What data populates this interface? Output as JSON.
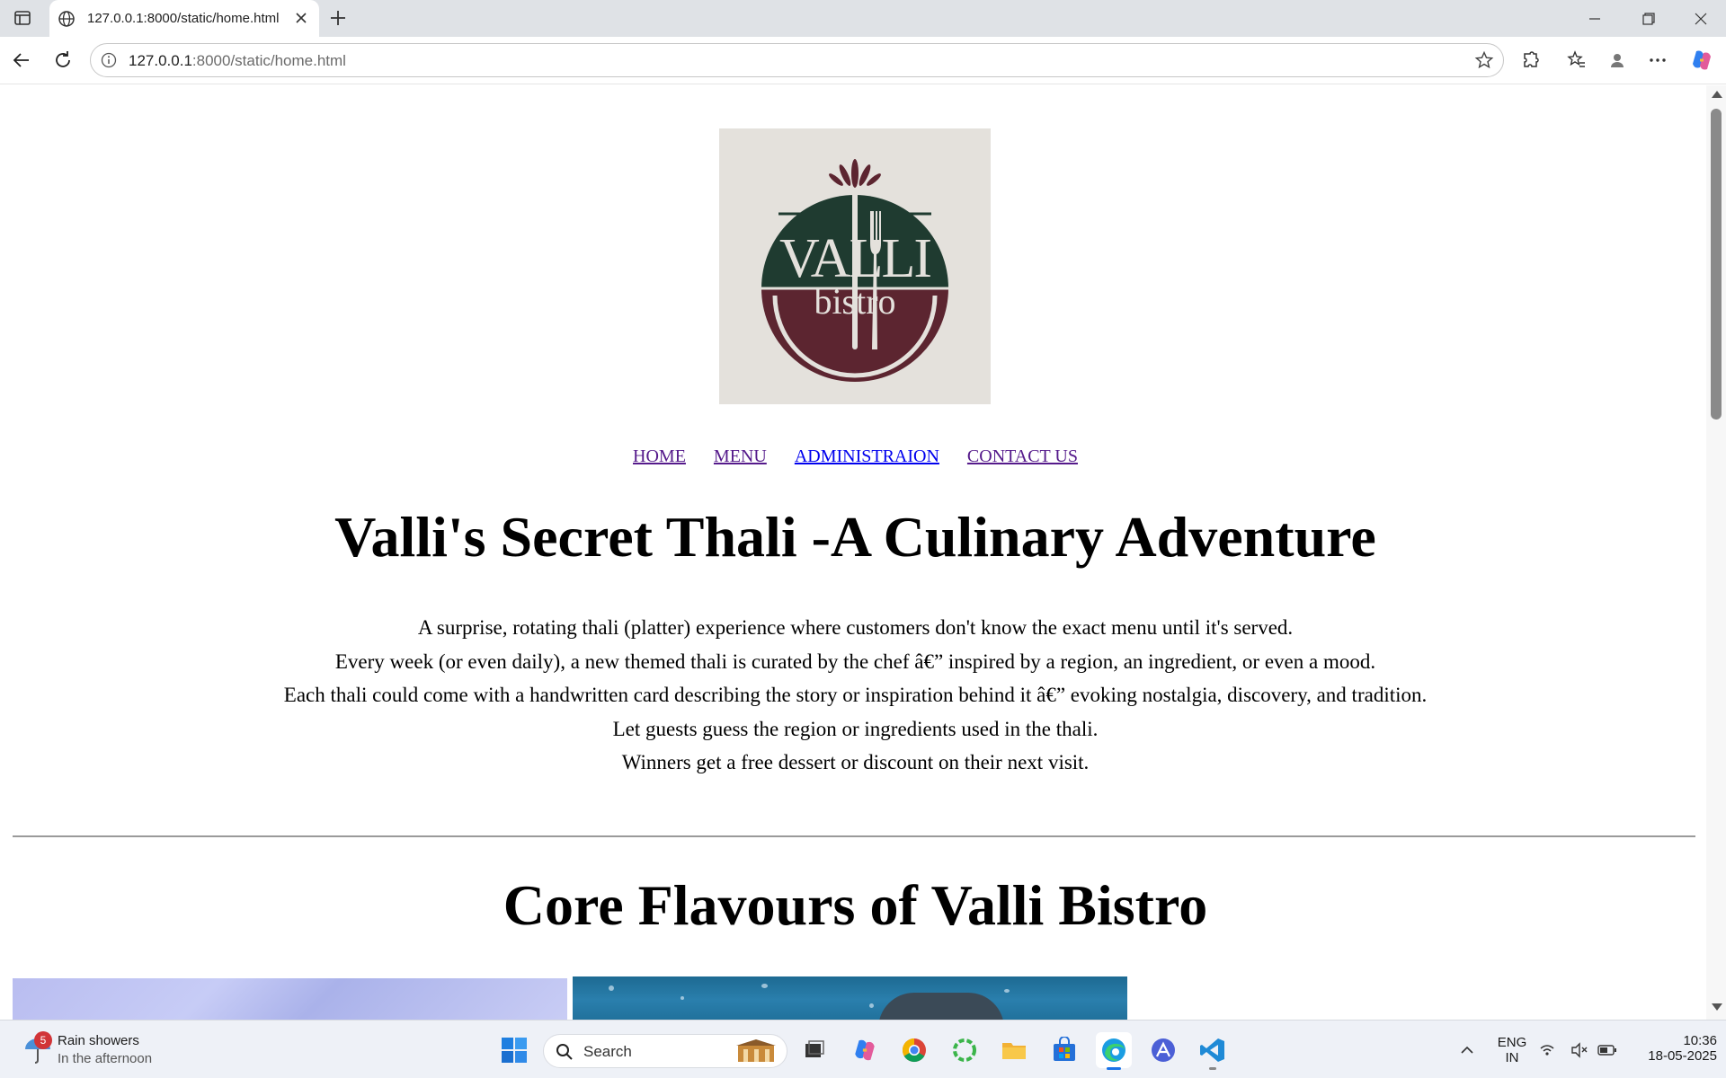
{
  "browser": {
    "tab_title": "127.0.0.1:8000/static/home.html",
    "url_host": "127.0.0.1",
    "url_rest": ":8000/static/home.html"
  },
  "page": {
    "nav": [
      {
        "label": "HOME",
        "visited": true
      },
      {
        "label": "MENU",
        "visited": true
      },
      {
        "label": "ADMINISTRAION",
        "visited": false
      },
      {
        "label": "CONTACT US",
        "visited": true
      }
    ],
    "logo": {
      "top_text": "VALLI",
      "bottom_text": "bistro",
      "colors": {
        "green": "#1f3b30",
        "maroon": "#5c2530",
        "cream": "#e4e1dc"
      }
    },
    "headline": "Valli's Secret Thali -A Culinary Adventure",
    "description_lines": [
      "A surprise, rotating thali (platter) experience where customers don't know the exact menu until it's served.",
      "Every week (or even daily), a new themed thali is curated by the chef â€” inspired by a region, an ingredient, or even a mood.",
      "Each thali could come with a handwritten card describing the story or inspiration behind it â€” evoking nostalgia, discovery, and tradition.",
      "Let guests guess the region or ingredients used in the thali.",
      "Winners get a free dessert or discount on their next visit."
    ],
    "section_title": "Core Flavours of Valli Bistro"
  },
  "taskbar": {
    "weather_badge": "5",
    "weather_title": "Rain showers",
    "weather_sub": "In the afternoon",
    "search_label": "Search",
    "lang_top": "ENG",
    "lang_bottom": "IN",
    "time": "10:36",
    "date": "18-05-2025"
  }
}
